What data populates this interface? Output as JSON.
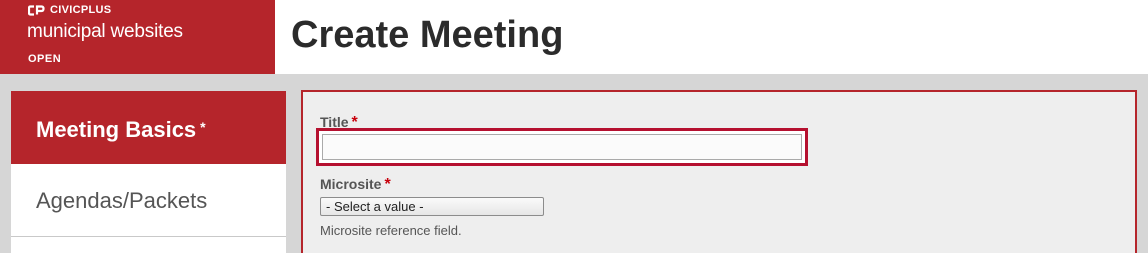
{
  "brand": {
    "logo_text": "CIVICPLUS",
    "product": "municipal websites",
    "status": "OPEN"
  },
  "page": {
    "title": "Create Meeting"
  },
  "sidebar": {
    "items": [
      {
        "label": "Meeting Basics",
        "required_mark": "*",
        "active": true
      },
      {
        "label": "Agendas/Packets",
        "active": false
      }
    ]
  },
  "form": {
    "title_field": {
      "label": "Title",
      "required_mark": "*",
      "value": ""
    },
    "microsite_field": {
      "label": "Microsite",
      "required_mark": "*",
      "selected": "- Select a value -",
      "help": "Microsite reference field."
    }
  },
  "colors": {
    "brand_red": "#b5252b",
    "focus_red": "#b5102f",
    "required_star": "#c7000b"
  }
}
